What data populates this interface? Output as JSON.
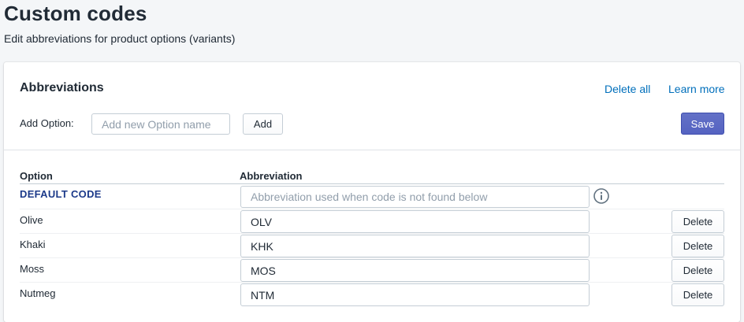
{
  "page": {
    "title": "Custom codes",
    "subtitle": "Edit abbreviations for product options (variants)"
  },
  "card": {
    "title": "Abbreviations",
    "delete_all_label": "Delete all",
    "learn_more_label": "Learn more",
    "add_option_label": "Add Option:",
    "add_option_placeholder": "Add new Option name",
    "add_option_value": "",
    "add_button_label": "Add",
    "save_button_label": "Save"
  },
  "table": {
    "headers": [
      "Option",
      "Abbreviation"
    ],
    "default_code": {
      "label": "DEFAULT CODE",
      "placeholder": "Abbreviation used when code is not found below",
      "value": "",
      "icon": "info-icon"
    },
    "rows": [
      {
        "option": "Olive",
        "abbreviation": "OLV",
        "delete_label": "Delete"
      },
      {
        "option": "Khaki",
        "abbreviation": "KHK",
        "delete_label": "Delete"
      },
      {
        "option": "Moss",
        "abbreviation": "MOS",
        "delete_label": "Delete"
      },
      {
        "option": "Nutmeg",
        "abbreviation": "NTM",
        "delete_label": "Delete"
      }
    ]
  },
  "colors": {
    "link": "#006fbb",
    "primary_button": "#5c6ac4",
    "default_code_label": "#1c3a8a",
    "background": "#f4f6f8"
  }
}
